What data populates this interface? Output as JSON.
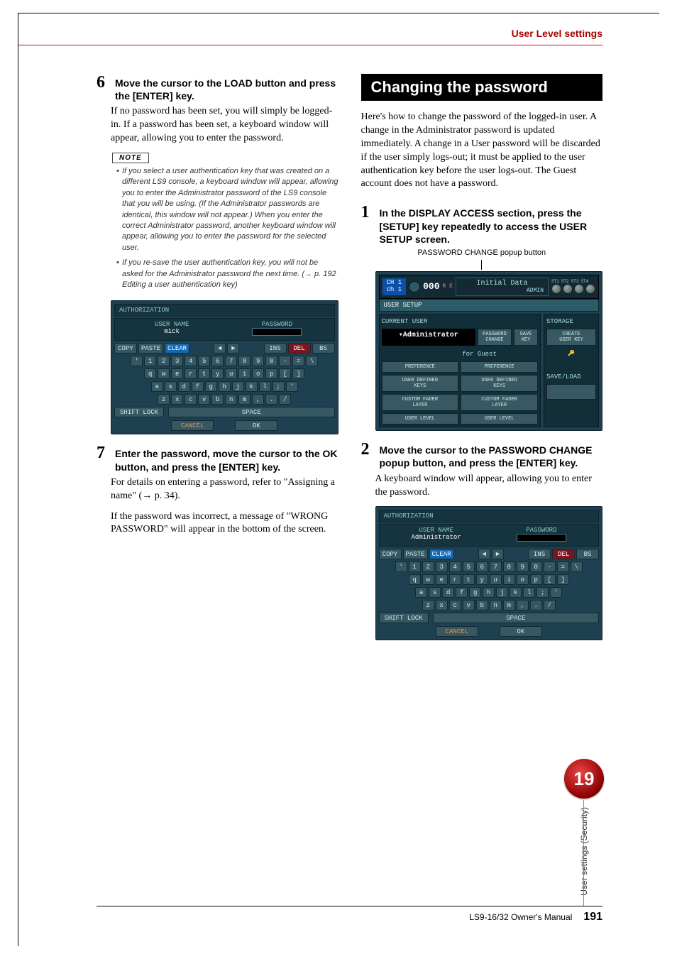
{
  "header": {
    "title": "User Level settings"
  },
  "left": {
    "step6": {
      "num": "6",
      "title": "Move the cursor to the LOAD button and press the [ENTER] key.",
      "body": "If no password has been set, you will simply be logged-in. If a password has been set, a keyboard window will appear, allowing you to enter the password."
    },
    "note_label": "NOTE",
    "notes": [
      "If you select a user authentication key that was created on a different LS9 console, a keyboard window will appear, allowing you to enter the Administrator password of the LS9 console that you will be using. (If the Administrator passwords are identical, this window will not appear.) When you enter the correct Administrator password, another keyboard window will appear, allowing you to enter the password for the selected user.",
      "If you re-save the user authentication key, you will not be asked for the Administrator password the next time. (→ p. 192 Editing a user authentication key)"
    ],
    "auth": {
      "title": "AUTHORIZATION",
      "user_label": "USER NAME",
      "user": "mick",
      "pass_label": "PASSWORD",
      "copy": "COPY",
      "paste": "PASTE",
      "clear": "CLEAR",
      "ins": "INS",
      "del": "DEL",
      "bs": "BS",
      "row1": [
        "'",
        "1",
        "2",
        "3",
        "4",
        "5",
        "6",
        "7",
        "8",
        "9",
        "0",
        "-",
        "=",
        "\\"
      ],
      "row2": [
        "q",
        "w",
        "e",
        "r",
        "t",
        "y",
        "u",
        "i",
        "o",
        "p",
        "[",
        "]"
      ],
      "row3": [
        "a",
        "s",
        "d",
        "f",
        "g",
        "h",
        "j",
        "k",
        "l",
        ";",
        "'"
      ],
      "row4": [
        "z",
        "x",
        "c",
        "v",
        "b",
        "n",
        "m",
        ",",
        ".",
        "/"
      ],
      "shift": "SHIFT LOCK",
      "space": "SPACE",
      "cancel": "CANCEL",
      "ok": "OK"
    },
    "step7": {
      "num": "7",
      "title": "Enter the password, move the cursor to the OK button, and press the [ENTER] key.",
      "body1": "For details on entering a password, refer to \"Assigning a name\" (→ p. 34).",
      "body2": "If the password was incorrect, a message of \"WRONG PASSWORD\" will appear in the bottom of the screen."
    }
  },
  "right": {
    "section_title": "Changing the password",
    "section_body": "Here's how to change the password of the logged-in user. A change in the Administrator password is updated immediately. A change in a User password will be discarded if the user simply logs-out; it must be applied to the user authentication key before the user logs-out. The Guest account does not have a password.",
    "step1": {
      "num": "1",
      "title": "In the DISPLAY ACCESS section, press the [SETUP] key repeatedly to access the USER SETUP screen."
    },
    "caption": "PASSWORD CHANGE popup button",
    "setup": {
      "ch": "CH 1\nch 1",
      "scene": "000",
      "init_top": "Initial Data",
      "init_sub": "ADMIN",
      "st": [
        "ST1",
        "ST2",
        "ST3",
        "ST4"
      ],
      "tab": "USER SETUP",
      "current": "CURRENT USER",
      "admin": "▾Administrator",
      "pwdchange": "PASSWORD\nCHANGE",
      "savekey": "SAVE\nKEY",
      "guest": "for Guest",
      "btns": [
        "PREFERENCE",
        "USER DEFINED\nKEYS",
        "CUSTOM FADER\nLAYER",
        "USER LEVEL"
      ],
      "storage": "STORAGE",
      "create": "CREATE\nUSER KEY",
      "saveload": "SAVE/LOAD"
    },
    "step2": {
      "num": "2",
      "title": "Move the cursor to the PASSWORD CHANGE popup button, and press the [ENTER] key.",
      "body": "A keyboard window will appear, allowing you to enter the password."
    },
    "auth2": {
      "title": "AUTHORIZATION",
      "user_label": "USER NAME",
      "user": "Administrator",
      "pass_label": "PASSWORD"
    }
  },
  "chapter": {
    "num": "19",
    "label": "User settings (Security)"
  },
  "footer": {
    "manual": "LS9-16/32  Owner's Manual",
    "page": "191"
  }
}
